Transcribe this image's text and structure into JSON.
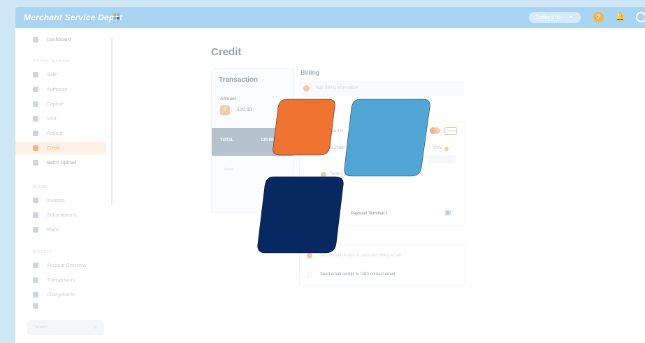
{
  "app": {
    "brand": "Merchant Service Depot",
    "org_selector": "Dobby LTD",
    "help_icon": "question-icon",
    "bell_icon": "bell-icon"
  },
  "sidebar": {
    "dashboard": "Dashboard",
    "section_virtual_terminal": "VIRTUAL TERMINAL",
    "vt_items": [
      {
        "label": "Sale",
        "icon": "sale-icon"
      },
      {
        "label": "Authorize",
        "icon": "authorize-icon"
      },
      {
        "label": "Capture",
        "icon": "capture-icon"
      },
      {
        "label": "Void",
        "icon": "void-icon"
      },
      {
        "label": "Refund",
        "icon": "refund-icon"
      },
      {
        "label": "Credit",
        "icon": "credit-icon",
        "active": true
      },
      {
        "label": "Batch Upload",
        "icon": "upload-icon"
      }
    ],
    "section_billing": "BILLING",
    "billing_items": [
      {
        "label": "Invoices",
        "icon": "invoice-icon"
      },
      {
        "label": "Subscriptions",
        "icon": "subscription-icon"
      },
      {
        "label": "Plans",
        "icon": "plans-icon"
      }
    ],
    "section_reports": "REPORTS",
    "report_items": [
      {
        "label": "Account Overview",
        "icon": "chart-icon"
      },
      {
        "label": "Transactions",
        "icon": "list-icon"
      },
      {
        "label": "Chargebacks",
        "icon": "chargeback-icon"
      }
    ],
    "search_placeholder": "Search..."
  },
  "main": {
    "title": "Credit",
    "transaction": {
      "title": "Transaction",
      "amount_label": "Amount",
      "currency_symbol": "$",
      "amount": "120.00",
      "total_label": "TOTAL",
      "total_value": "120.00"
    },
    "memo_placeholder": "Memo",
    "billing": {
      "title": "Billing",
      "add_info": "Add Billing Information"
    },
    "card_panel": {
      "card_label": "Card N",
      "number_label": "Number",
      "cvv_label": "CVV",
      "save_label": "Save c",
      "discover": "DISCOVER",
      "terminal": "Payment Terminal 1"
    },
    "receipt": {
      "option_customer": "Send email receipt to customer billing email",
      "option_dba": "Send email receipt to DBA contact email"
    }
  },
  "colors": {
    "orange": "#ef7331",
    "blue": "#52a6d6",
    "navy": "#082862",
    "topbar": "#a9d4f1"
  }
}
